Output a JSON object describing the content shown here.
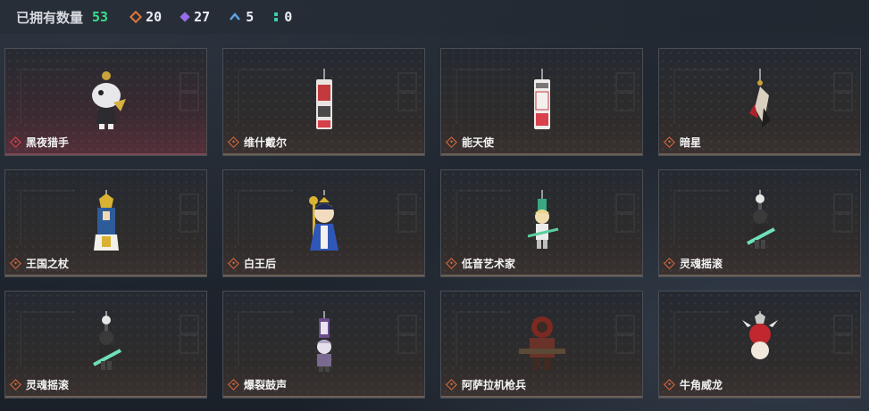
{
  "header": {
    "owned_label": "已拥有数量",
    "owned_count": "53",
    "stats": [
      {
        "icon": "orange-diamond-icon",
        "color": "#e0763a",
        "value": "20"
      },
      {
        "icon": "purple-diamond-icon",
        "color": "#9a6be8",
        "value": "27"
      },
      {
        "icon": "blue-chevron-icon",
        "color": "#5fa6e6",
        "value": "5"
      },
      {
        "icon": "green-dots-icon",
        "color": "#3ad1a6",
        "value": "0"
      }
    ]
  },
  "items": [
    {
      "name": "黑夜猎手",
      "rarity": "red"
    },
    {
      "name": "维什戴尔",
      "rarity": "orange"
    },
    {
      "name": "能天使",
      "rarity": "orange"
    },
    {
      "name": "暗星",
      "rarity": "orange"
    },
    {
      "name": "王国之杖",
      "rarity": "orange"
    },
    {
      "name": "白王后",
      "rarity": "orange"
    },
    {
      "name": "低音艺术家",
      "rarity": "orange"
    },
    {
      "name": "灵魂摇滚",
      "rarity": "orange"
    },
    {
      "name": "灵魂摇滚",
      "rarity": "orange"
    },
    {
      "name": "爆裂鼓声",
      "rarity": "orange"
    },
    {
      "name": "阿萨拉机枪兵",
      "rarity": "orange"
    },
    {
      "name": "牛角威龙",
      "rarity": "orange"
    }
  ]
}
